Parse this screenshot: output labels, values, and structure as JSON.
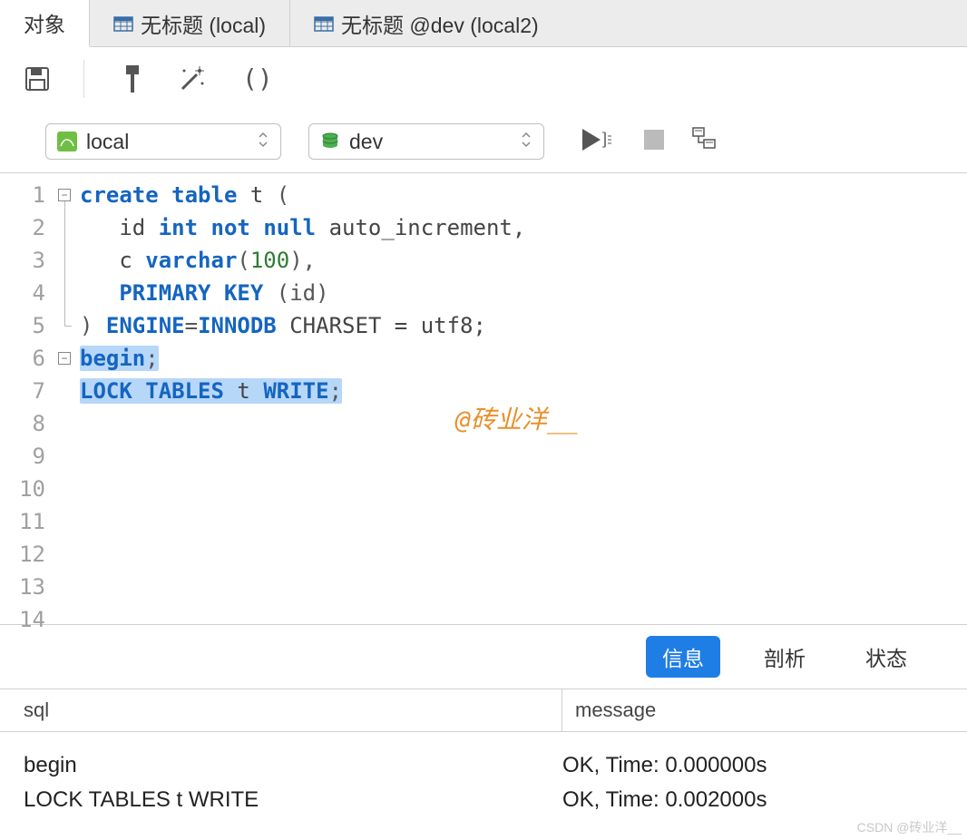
{
  "tabs": [
    {
      "label": "对象",
      "icon": null
    },
    {
      "label": "无标题 (local)",
      "icon": "table"
    },
    {
      "label": "无标题 @dev (local2)",
      "icon": "table"
    }
  ],
  "toolbar": {
    "save": "save-icon",
    "hammer": "hammer-icon",
    "wand": "wand-icon",
    "parens": "parens-icon"
  },
  "connection": {
    "label": "local"
  },
  "database": {
    "label": "dev"
  },
  "editor": {
    "lines": [
      "1",
      "2",
      "3",
      "4",
      "5",
      "6",
      "7",
      "8",
      "9",
      "10",
      "11",
      "12",
      "13",
      "14"
    ],
    "sql": {
      "l1": {
        "a": "create",
        "b": "table",
        "c": " t ",
        "d": "("
      },
      "l2": {
        "a": "   id ",
        "b": "int",
        "c": "not",
        "d": "null",
        "e": " auto_increment,"
      },
      "l3": {
        "a": "   c ",
        "b": "varchar",
        "c": "(",
        "d": "100",
        "e": "),"
      },
      "l4": {
        "a": "   ",
        "b": "PRIMARY",
        "c": "KEY",
        "d": " (id)"
      },
      "l5": {
        "a": ") ",
        "b": "ENGINE",
        "c": "=",
        "d": "INNODB",
        "e": " CHARSET = utf8;"
      },
      "l6": {
        "a": "begin",
        "b": ";"
      },
      "l7": {
        "a": "LOCK",
        "b": "TABLES",
        "c": " t ",
        "d": "WRITE",
        "e": ";"
      }
    }
  },
  "watermark": "@砖业洋__",
  "csdn_watermark": "CSDN @砖业洋__",
  "result_tabs": {
    "info": "信息",
    "profile": "剖析",
    "state": "状态"
  },
  "result_head": {
    "sql": "sql",
    "msg": "message"
  },
  "results": [
    {
      "sql": "begin",
      "msg": "OK, Time: 0.000000s"
    },
    {
      "sql": "LOCK TABLES t WRITE",
      "msg": "OK, Time: 0.002000s"
    }
  ]
}
